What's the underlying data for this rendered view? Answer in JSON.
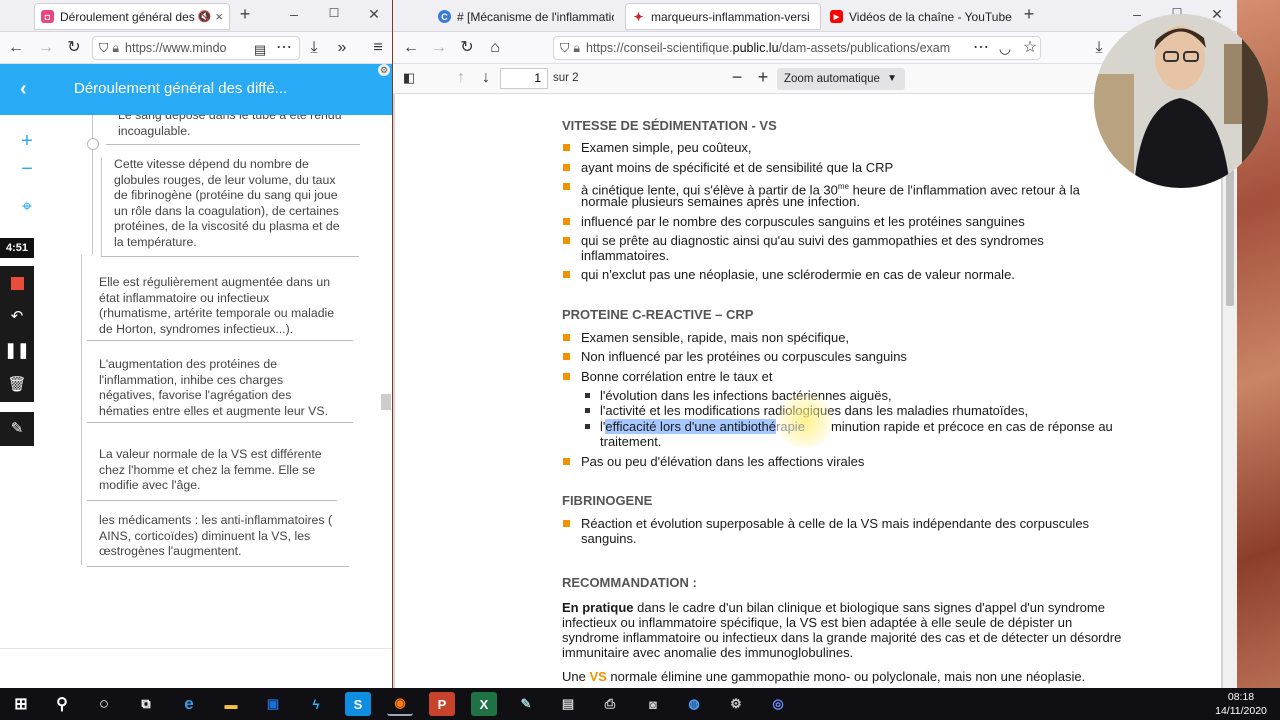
{
  "left_window": {
    "tab": {
      "title": "Déroulement général des d",
      "close": "×"
    },
    "new_tab": "+",
    "controls": {
      "minimize": "–",
      "maximize": "☐",
      "close": "✕"
    },
    "url": "https://www.mindo",
    "mindmap_title": "Déroulement général des diffé...",
    "nodes": [
      {
        "text": "Le sang déposé dans le tube a été rendu incoagulable."
      },
      {
        "text": "Cette vitesse dépend du nombre de globules rouges, de leur volume, du taux de fibrinogène (protéine du sang qui joue un rôle dans la coagulation), de certaines protéines, de la viscosité du plasma et de la température."
      },
      {
        "text": "Elle est régulièrement augmentée dans un état inflammatoire ou infectieux (rhumatisme, artérite temporale ou maladie de Horton, syndromes infectieux...)."
      },
      {
        "text": "L'augmentation des protéines de l'inflammation, inhibe ces charges négatives, favorise l'agrégation des hématies entre elles et augmente leur VS."
      },
      {
        "text": "La valeur normale de la VS est différente chez l'homme et chez la femme. Elle se modifie avec l'âge."
      },
      {
        "text": "les médicaments : les anti-inflammatoires ( AINS, corticoïdes) diminuent la VS, les œstrogènes l'augmentent."
      }
    ],
    "tools": {
      "zoom_in": "+",
      "zoom_out": "−"
    },
    "recorder": {
      "time": "4:51"
    }
  },
  "right_window": {
    "tabs": [
      {
        "title": "# [Mécanisme de l'inflammatio",
        "favicon": "C",
        "color": "#3b7bd8"
      },
      {
        "title": "marqueurs-inflammation-versi",
        "favicon": "✦",
        "color": "#d2232a",
        "active": true
      },
      {
        "title": "Vidéos de la chaîne - YouTube",
        "favicon": "▶",
        "color": "#ff0000"
      }
    ],
    "new_tab": "+",
    "controls": {
      "minimize": "–",
      "maximize": "☐",
      "close": "✕"
    },
    "url_prefix": "https://conseil-scientifique.",
    "url_domain": "public.lu",
    "url_rest": "/dam-assets/publications/exam",
    "pdf": {
      "page_number": "1",
      "page_total": "sur 2",
      "zoom": "Zoom automatique",
      "sections": {
        "vs_title": "VITESSE DE SÉDIMENTATION - VS",
        "vs_items": [
          "Examen simple, peu coûteux,",
          "ayant moins de spécificité et de sensibilité que la CRP",
          "à cinétique lente, qui s'élève à partir de la 30",
          "normale plusieurs semaines après une infection.",
          "influencé par le nombre des corpuscules sanguins et les protéines sanguines",
          "qui se prête au diagnostic ainsi qu'au suivi des gammopathies et des syndromes",
          "inflammatoires.",
          "qui n'exclut pas une néoplasie, une sclérodermie en cas de valeur normale."
        ],
        "vs_sup": "me",
        "vs_item3_tail": " heure de l'inflammation avec retour à la",
        "crp_title": "PROTEINE C-REACTIVE – CRP",
        "crp_items": [
          "Examen sensible, rapide, mais non spécifique,",
          "Non influencé par les protéines ou corpuscules sanguins",
          "Bonne corrélation entre le taux et",
          "Pas ou peu d'élévation dans les affections virales"
        ],
        "crp_sub": [
          "l'évolution dans les infections bactériennes aiguës,",
          "l'activité et les modifications radiologiques dans les maladies rhumatoïdes,"
        ],
        "crp_sub3_pre": "l'",
        "crp_sub3_hl": "efficacité lors d'une antibiothé",
        "crp_sub3_mid": "rapie",
        "crp_sub3_post": "minution rapide et précoce en cas de réponse au",
        "crp_sub3_line2": "traitement.",
        "fib_title": "FIBRINOGENE",
        "fib_item_1": "Réaction et évolution superposable à celle de la VS mais indépendante des corpuscules",
        "fib_item_2": "sanguins.",
        "rec_title": "RECOMMANDATION",
        "rec_colon": " :",
        "rec_bold": "En pratique",
        "rec_lines": [
          " dans le cadre d'un bilan clinique et biologique sans signes d'appel d'un syndrome",
          "infectieux ou inflammatoire spécifique, la VS est bien adaptée à elle seule de dépister un",
          "syndrome inflammatoire ou infectieux dans la grande majorité des cas et de détecter un désordre",
          "immunitaire avec anomalie des immunoglobulines."
        ],
        "rec_last_pre": "Une ",
        "rec_last_vs": "VS",
        "rec_last_post": " normale élimine une gammopathie mono- ou polyclonale, mais non une néoplasie."
      }
    }
  },
  "taskbar": {
    "time": "08:18",
    "date": "14/11/2020"
  }
}
